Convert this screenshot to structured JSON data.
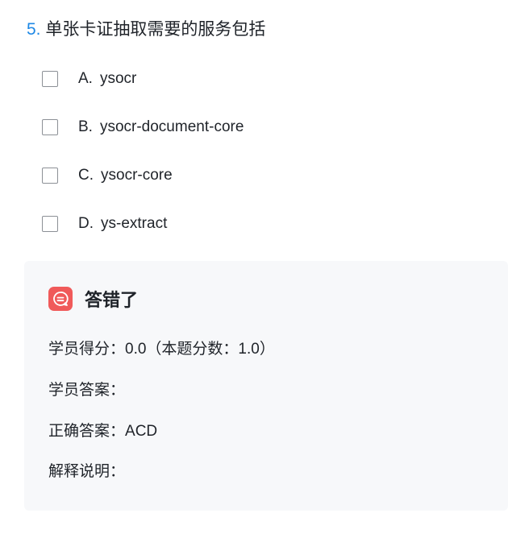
{
  "question": {
    "number": "5.",
    "title": "单张卡证抽取需要的服务包括"
  },
  "options": [
    {
      "letter": "A.",
      "text": "ysocr",
      "checked": false
    },
    {
      "letter": "B.",
      "text": "ysocr-document-core",
      "checked": false
    },
    {
      "letter": "C.",
      "text": "ysocr-core",
      "checked": false
    },
    {
      "letter": "D.",
      "text": "ys-extract",
      "checked": false
    }
  ],
  "result": {
    "status_icon": "chat-bubble-icon",
    "status_text": "答错了",
    "accent_color": "#f05a5a",
    "score_label": "学员得分：",
    "score_value": "0.0（本题分数：1.0）",
    "student_answer_label": "学员答案：",
    "student_answer_value": "",
    "correct_answer_label": "正确答案：",
    "correct_answer_value": "ACD",
    "explanation_label": "解释说明：",
    "explanation_value": ""
  },
  "colors": {
    "question_number": "#1e88e5",
    "panel_background": "#f7f8fa"
  }
}
